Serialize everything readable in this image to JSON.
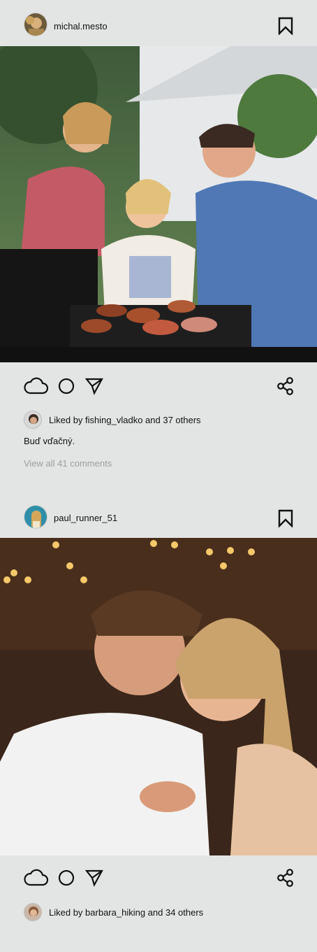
{
  "posts": [
    {
      "username": "michal.mesto",
      "liked_by_prefix": "Liked by ",
      "liked_by_user": "fishing_vladko",
      "liked_by_suffix": " and 37 others",
      "caption": "Buď vďačný.",
      "view_comments": "View all 41 comments",
      "photo_desc": "family grilling sausages on a barbecue in a backyard"
    },
    {
      "username": "paul_runner_51",
      "liked_by_prefix": "Liked by ",
      "liked_by_user": "barbara_hiking",
      "liked_by_suffix": " and 34 others",
      "photo_desc": "young couple embracing under string lights"
    }
  ],
  "icons": {
    "like": "cloud-icon",
    "comment": "circle-icon",
    "share": "send-icon",
    "repost": "share-nodes-icon",
    "save": "bookmark-icon"
  },
  "colors": {
    "background": "#e3e5e4",
    "muted_text": "#9aa09e",
    "text": "#111111"
  }
}
